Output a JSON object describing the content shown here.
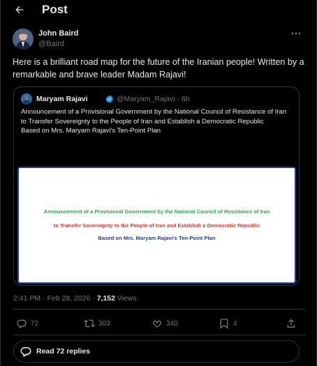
{
  "header": {
    "title": "Post"
  },
  "author": {
    "name": "John Baird",
    "handle": "@Baird"
  },
  "tweet": {
    "text": "Here is a brilliant road map for the future of the Iranian people! Written by a remarkable and brave leader Madam Rajavi!"
  },
  "quoted": {
    "name": "Maryam Rajavi",
    "handle": "@Maryam_Rajavi",
    "separator": "·",
    "age": "6h",
    "lines": [
      "Announcement of a Provisional Government by the National Council of Resistance of Iran",
      "to Transfer Sovereignty to the People of Iran and Establish a Democratic Republic",
      "Based on Mrs. Maryam Rajavi's Ten-Point Plan"
    ],
    "image": {
      "line1": "Announcement of a Provisional Government by the National Council of Resistance of Iran",
      "line2": "to Transfer Sovereignty to the People of Iran and Establish a Democratic Republic",
      "line3": "Based on Mrs. Maryam Rajavi's Ten-Point Plan"
    }
  },
  "timestamp": {
    "time": "2:41 PM",
    "sep1": "·",
    "date": "Feb 28, 2026",
    "sep2": "·",
    "views": "7,152",
    "views_label": "Views"
  },
  "actions": {
    "replies": "72",
    "reposts": "303",
    "likes": "340",
    "bookmarks": "4"
  },
  "read_replies": {
    "label": "Read 72 replies"
  },
  "colors": {
    "background": "#000000",
    "text": "#e7e9ea",
    "muted": "#71767b",
    "border": "#2f3336",
    "verified": "#1d9bf0",
    "image_green": "#2ea44f",
    "image_red": "#e0342b",
    "image_blue": "#1f3da6"
  }
}
